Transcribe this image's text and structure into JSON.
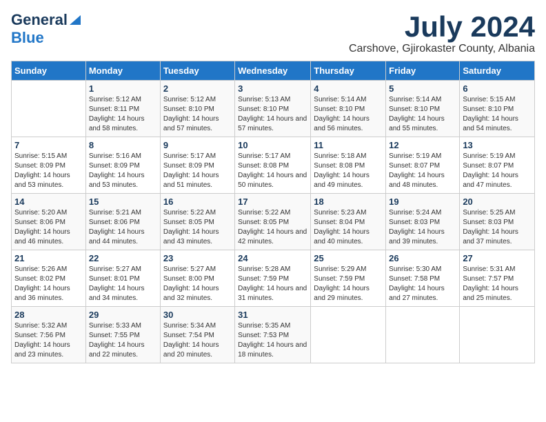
{
  "header": {
    "logo_general": "General",
    "logo_blue": "Blue",
    "month_year": "July 2024",
    "location": "Carshove, Gjirokaster County, Albania"
  },
  "weekdays": [
    "Sunday",
    "Monday",
    "Tuesday",
    "Wednesday",
    "Thursday",
    "Friday",
    "Saturday"
  ],
  "weeks": [
    [
      {
        "day": "",
        "sunrise": "",
        "sunset": "",
        "daylight": ""
      },
      {
        "day": "1",
        "sunrise": "Sunrise: 5:12 AM",
        "sunset": "Sunset: 8:11 PM",
        "daylight": "Daylight: 14 hours and 58 minutes."
      },
      {
        "day": "2",
        "sunrise": "Sunrise: 5:12 AM",
        "sunset": "Sunset: 8:10 PM",
        "daylight": "Daylight: 14 hours and 57 minutes."
      },
      {
        "day": "3",
        "sunrise": "Sunrise: 5:13 AM",
        "sunset": "Sunset: 8:10 PM",
        "daylight": "Daylight: 14 hours and 57 minutes."
      },
      {
        "day": "4",
        "sunrise": "Sunrise: 5:14 AM",
        "sunset": "Sunset: 8:10 PM",
        "daylight": "Daylight: 14 hours and 56 minutes."
      },
      {
        "day": "5",
        "sunrise": "Sunrise: 5:14 AM",
        "sunset": "Sunset: 8:10 PM",
        "daylight": "Daylight: 14 hours and 55 minutes."
      },
      {
        "day": "6",
        "sunrise": "Sunrise: 5:15 AM",
        "sunset": "Sunset: 8:10 PM",
        "daylight": "Daylight: 14 hours and 54 minutes."
      }
    ],
    [
      {
        "day": "7",
        "sunrise": "Sunrise: 5:15 AM",
        "sunset": "Sunset: 8:09 PM",
        "daylight": "Daylight: 14 hours and 53 minutes."
      },
      {
        "day": "8",
        "sunrise": "Sunrise: 5:16 AM",
        "sunset": "Sunset: 8:09 PM",
        "daylight": "Daylight: 14 hours and 53 minutes."
      },
      {
        "day": "9",
        "sunrise": "Sunrise: 5:17 AM",
        "sunset": "Sunset: 8:09 PM",
        "daylight": "Daylight: 14 hours and 51 minutes."
      },
      {
        "day": "10",
        "sunrise": "Sunrise: 5:17 AM",
        "sunset": "Sunset: 8:08 PM",
        "daylight": "Daylight: 14 hours and 50 minutes."
      },
      {
        "day": "11",
        "sunrise": "Sunrise: 5:18 AM",
        "sunset": "Sunset: 8:08 PM",
        "daylight": "Daylight: 14 hours and 49 minutes."
      },
      {
        "day": "12",
        "sunrise": "Sunrise: 5:19 AM",
        "sunset": "Sunset: 8:07 PM",
        "daylight": "Daylight: 14 hours and 48 minutes."
      },
      {
        "day": "13",
        "sunrise": "Sunrise: 5:19 AM",
        "sunset": "Sunset: 8:07 PM",
        "daylight": "Daylight: 14 hours and 47 minutes."
      }
    ],
    [
      {
        "day": "14",
        "sunrise": "Sunrise: 5:20 AM",
        "sunset": "Sunset: 8:06 PM",
        "daylight": "Daylight: 14 hours and 46 minutes."
      },
      {
        "day": "15",
        "sunrise": "Sunrise: 5:21 AM",
        "sunset": "Sunset: 8:06 PM",
        "daylight": "Daylight: 14 hours and 44 minutes."
      },
      {
        "day": "16",
        "sunrise": "Sunrise: 5:22 AM",
        "sunset": "Sunset: 8:05 PM",
        "daylight": "Daylight: 14 hours and 43 minutes."
      },
      {
        "day": "17",
        "sunrise": "Sunrise: 5:22 AM",
        "sunset": "Sunset: 8:05 PM",
        "daylight": "Daylight: 14 hours and 42 minutes."
      },
      {
        "day": "18",
        "sunrise": "Sunrise: 5:23 AM",
        "sunset": "Sunset: 8:04 PM",
        "daylight": "Daylight: 14 hours and 40 minutes."
      },
      {
        "day": "19",
        "sunrise": "Sunrise: 5:24 AM",
        "sunset": "Sunset: 8:03 PM",
        "daylight": "Daylight: 14 hours and 39 minutes."
      },
      {
        "day": "20",
        "sunrise": "Sunrise: 5:25 AM",
        "sunset": "Sunset: 8:03 PM",
        "daylight": "Daylight: 14 hours and 37 minutes."
      }
    ],
    [
      {
        "day": "21",
        "sunrise": "Sunrise: 5:26 AM",
        "sunset": "Sunset: 8:02 PM",
        "daylight": "Daylight: 14 hours and 36 minutes."
      },
      {
        "day": "22",
        "sunrise": "Sunrise: 5:27 AM",
        "sunset": "Sunset: 8:01 PM",
        "daylight": "Daylight: 14 hours and 34 minutes."
      },
      {
        "day": "23",
        "sunrise": "Sunrise: 5:27 AM",
        "sunset": "Sunset: 8:00 PM",
        "daylight": "Daylight: 14 hours and 32 minutes."
      },
      {
        "day": "24",
        "sunrise": "Sunrise: 5:28 AM",
        "sunset": "Sunset: 7:59 PM",
        "daylight": "Daylight: 14 hours and 31 minutes."
      },
      {
        "day": "25",
        "sunrise": "Sunrise: 5:29 AM",
        "sunset": "Sunset: 7:59 PM",
        "daylight": "Daylight: 14 hours and 29 minutes."
      },
      {
        "day": "26",
        "sunrise": "Sunrise: 5:30 AM",
        "sunset": "Sunset: 7:58 PM",
        "daylight": "Daylight: 14 hours and 27 minutes."
      },
      {
        "day": "27",
        "sunrise": "Sunrise: 5:31 AM",
        "sunset": "Sunset: 7:57 PM",
        "daylight": "Daylight: 14 hours and 25 minutes."
      }
    ],
    [
      {
        "day": "28",
        "sunrise": "Sunrise: 5:32 AM",
        "sunset": "Sunset: 7:56 PM",
        "daylight": "Daylight: 14 hours and 23 minutes."
      },
      {
        "day": "29",
        "sunrise": "Sunrise: 5:33 AM",
        "sunset": "Sunset: 7:55 PM",
        "daylight": "Daylight: 14 hours and 22 minutes."
      },
      {
        "day": "30",
        "sunrise": "Sunrise: 5:34 AM",
        "sunset": "Sunset: 7:54 PM",
        "daylight": "Daylight: 14 hours and 20 minutes."
      },
      {
        "day": "31",
        "sunrise": "Sunrise: 5:35 AM",
        "sunset": "Sunset: 7:53 PM",
        "daylight": "Daylight: 14 hours and 18 minutes."
      },
      {
        "day": "",
        "sunrise": "",
        "sunset": "",
        "daylight": ""
      },
      {
        "day": "",
        "sunrise": "",
        "sunset": "",
        "daylight": ""
      },
      {
        "day": "",
        "sunrise": "",
        "sunset": "",
        "daylight": ""
      }
    ]
  ]
}
